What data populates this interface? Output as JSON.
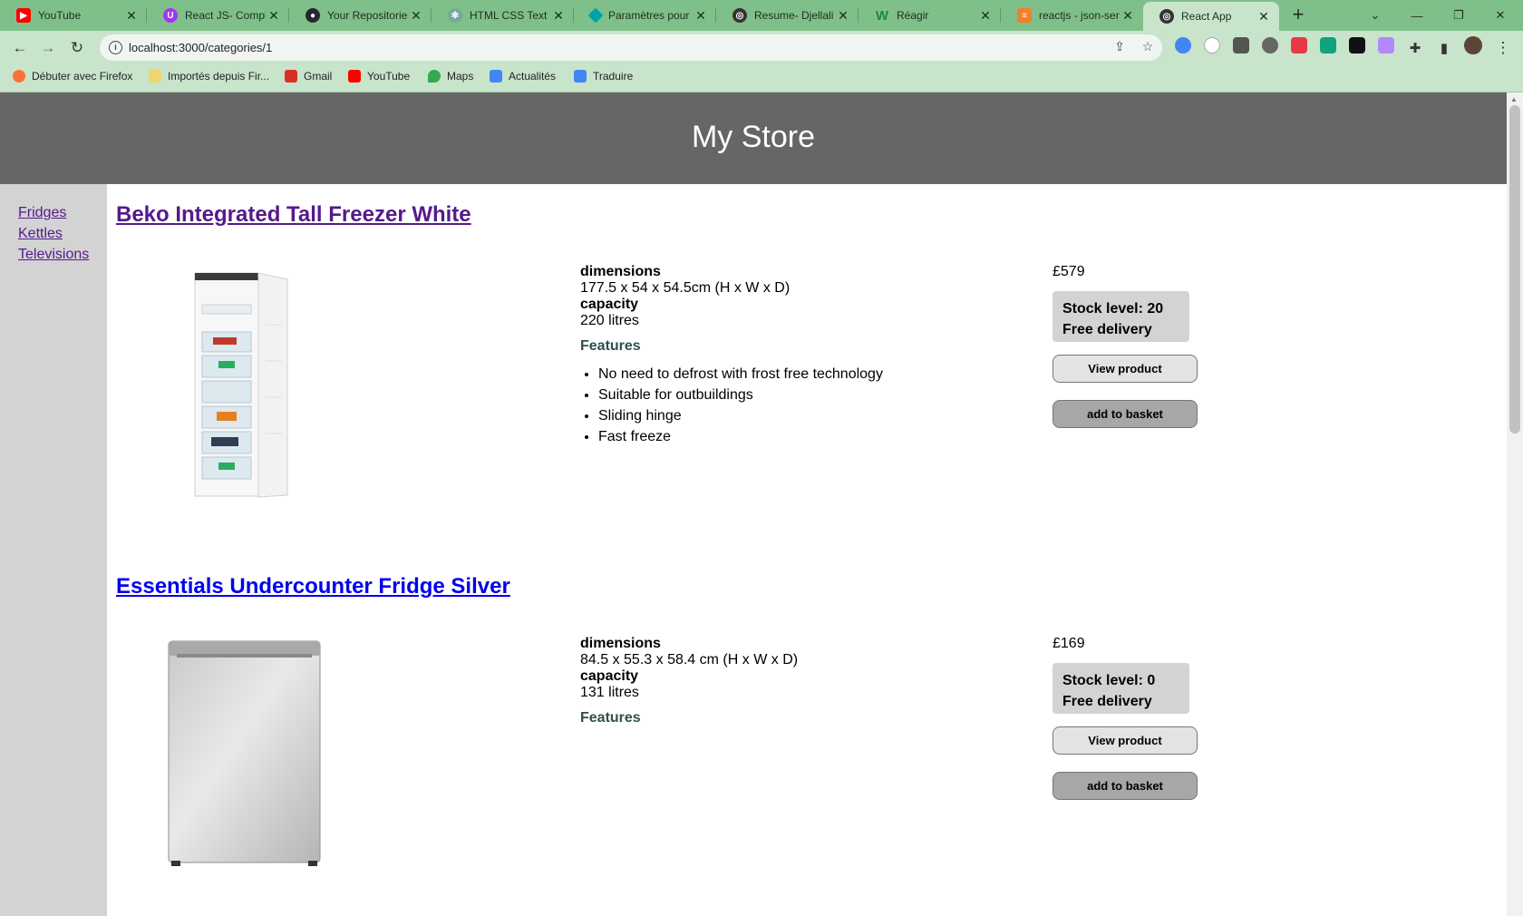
{
  "browser": {
    "tabs": [
      {
        "title": "YouTube",
        "icon": "youtube-icon",
        "color": "#ff0000"
      },
      {
        "title": "React JS- Comple",
        "icon": "course-icon",
        "color": "#a435f0"
      },
      {
        "title": "Your Repositories",
        "icon": "github-icon",
        "color": "#24292f"
      },
      {
        "title": "HTML CSS Text St",
        "icon": "chatgpt-icon",
        "color": "#74aa9c"
      },
      {
        "title": "Paramètres pour",
        "icon": "diamond-icon",
        "color": "#00a4a6"
      },
      {
        "title": "Resume- Djellali",
        "icon": "globe-icon",
        "color": "#333333"
      },
      {
        "title": "Réagir",
        "icon": "w-icon",
        "color": "#1b8c3a"
      },
      {
        "title": "reactjs - json-ser",
        "icon": "stackoverflow-icon",
        "color": "#f48024"
      },
      {
        "title": "React App",
        "icon": "globe-icon",
        "color": "#333333",
        "active": true
      }
    ],
    "url": "localhost:3000/categories/1",
    "bookmarks": [
      {
        "label": "Débuter avec Firefox",
        "icon": "firefox-icon",
        "color": "#ff7139"
      },
      {
        "label": "Importés depuis Fir...",
        "icon": "folder-icon",
        "color": "#f3d36b"
      },
      {
        "label": "Gmail",
        "icon": "gmail-icon",
        "color": "#d93025"
      },
      {
        "label": "YouTube",
        "icon": "youtube-icon",
        "color": "#ff0000"
      },
      {
        "label": "Maps",
        "icon": "maps-icon",
        "color": "#34a853"
      },
      {
        "label": "Actualités",
        "icon": "news-icon",
        "color": "#4285f4"
      },
      {
        "label": "Traduire",
        "icon": "translate-icon",
        "color": "#4285f4"
      }
    ]
  },
  "store": {
    "title": "My Store",
    "categories": [
      "Fridges",
      "Kettles",
      "Televisions"
    ],
    "products": [
      {
        "title": "Beko Integrated Tall Freezer White",
        "dimensions_label": "dimensions",
        "dimensions": "177.5 x 54 x 54.5cm (H x W x D)",
        "capacity_label": "capacity",
        "capacity": "220 litres",
        "features_label": "Features",
        "features": [
          "No need to defrost with frost free technology",
          "Suitable for outbuildings",
          "Sliding hinge",
          "Fast freeze"
        ],
        "price": "£579",
        "stock": "Stock level: 20",
        "delivery": "Free delivery",
        "view_label": "View product",
        "basket_label": "add to basket"
      },
      {
        "title": "Essentials Undercounter Fridge Silver",
        "dimensions_label": "dimensions",
        "dimensions": "84.5 x 55.3 x 58.4 cm (H x W x D)",
        "capacity_label": "capacity",
        "capacity": "131 litres",
        "features_label": "Features",
        "features": [],
        "price": "£169",
        "stock": "Stock level: 0",
        "delivery": "Free delivery",
        "view_label": "View product",
        "basket_label": "add to basket"
      }
    ]
  }
}
